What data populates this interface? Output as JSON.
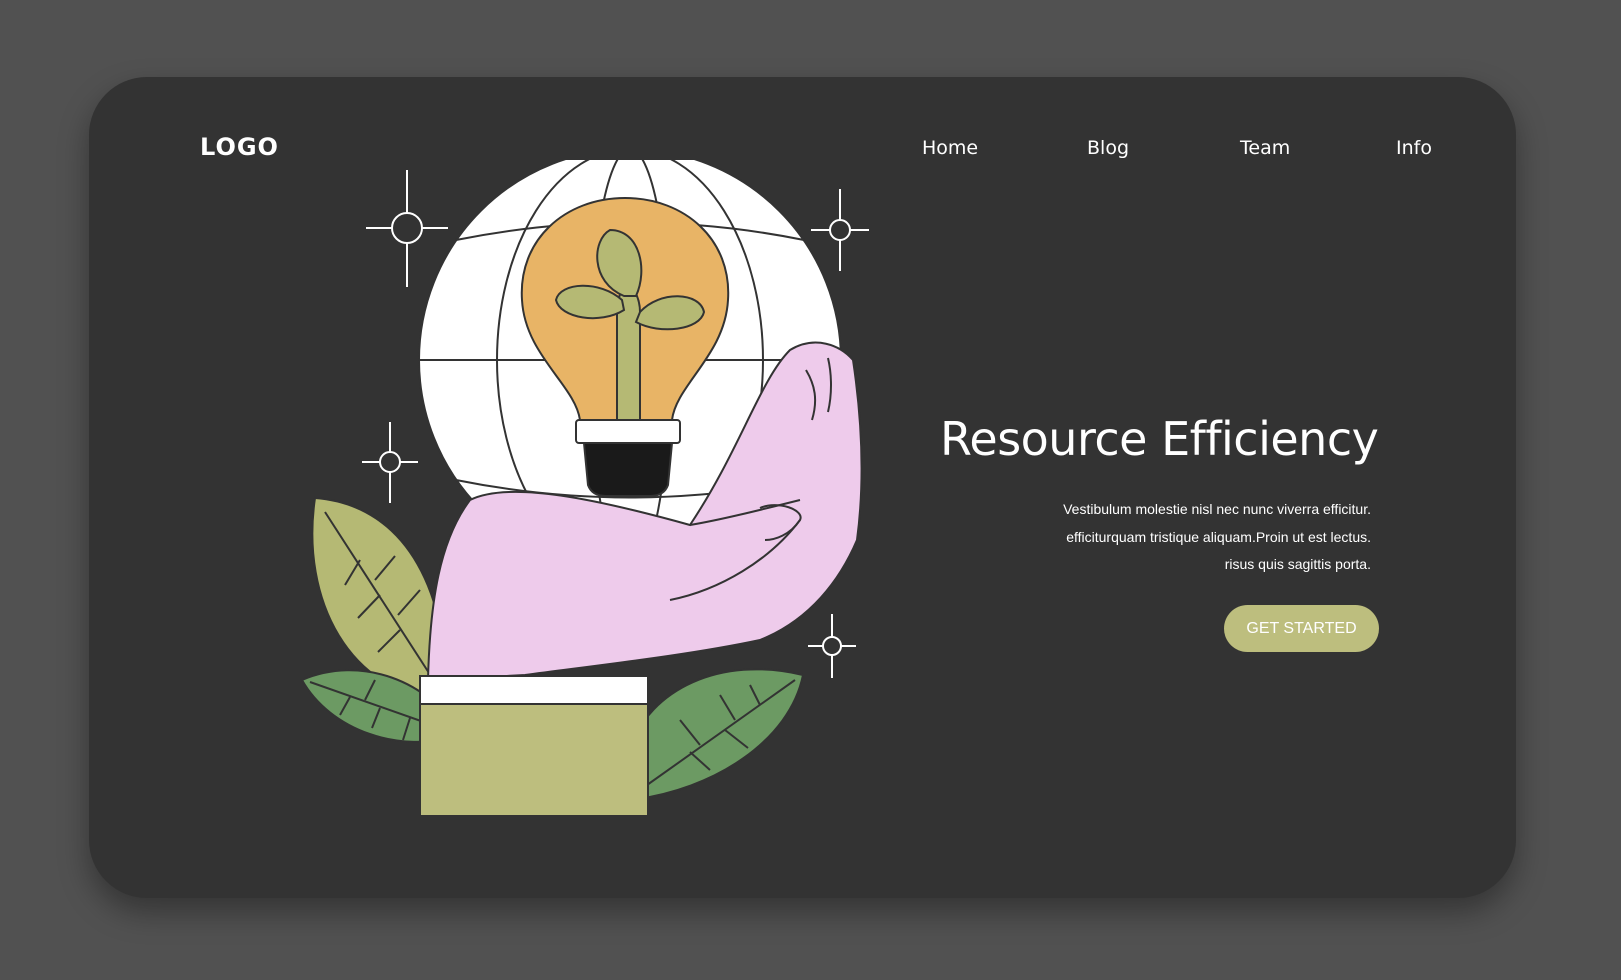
{
  "header": {
    "logo": "LOGO",
    "nav": [
      "Home",
      "Blog",
      "Team",
      "Info"
    ]
  },
  "hero": {
    "title": "Resource Efficiency",
    "description_lines": [
      "Vestibulum molestie nisl nec nunc viverra efficitur.",
      "efficiturquam tristique aliquam.Proin ut est lectus.",
      "risus quis sagittis porta."
    ],
    "cta_label": "GET STARTED"
  },
  "illustration": {
    "icons": [
      "globe-icon",
      "lightbulb-icon",
      "sprout-icon",
      "hand-icon",
      "leaf-icon",
      "sparkle-icon"
    ]
  },
  "colors": {
    "page_background": "#515151",
    "card_background": "#333333",
    "accent": "#BDBE7E",
    "bulb": "#E8B466",
    "hand": "#EECBEB",
    "leaf_light": "#B5B974",
    "leaf_dark": "#6C9A63",
    "sleeve": "#BDBE7E"
  }
}
